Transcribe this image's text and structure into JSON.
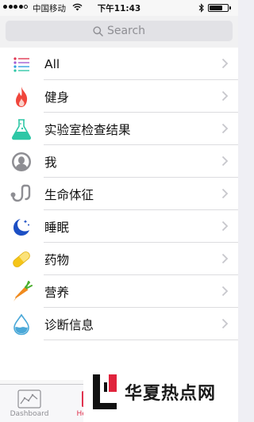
{
  "status_bar": {
    "carrier": "中国移动",
    "time": "下午11:43",
    "signal_dots_filled": 4,
    "battery_level": 0.65
  },
  "search": {
    "placeholder": "Search",
    "icon": "search-icon"
  },
  "categories": [
    {
      "label": "All",
      "icon": "list-icon"
    },
    {
      "label": "健身",
      "icon": "flame-icon"
    },
    {
      "label": "实验室检查结果",
      "icon": "flask-icon"
    },
    {
      "label": "我",
      "icon": "person-icon"
    },
    {
      "label": "生命体征",
      "icon": "stethoscope-icon"
    },
    {
      "label": "睡眠",
      "icon": "moon-icon"
    },
    {
      "label": "药物",
      "icon": "pill-icon"
    },
    {
      "label": "营养",
      "icon": "carrot-icon"
    },
    {
      "label": "诊断信息",
      "icon": "drop-icon"
    }
  ],
  "tab_bar": {
    "tabs": [
      {
        "label": "Dashboard",
        "icon": "dashboard-icon"
      },
      {
        "label": "Health",
        "icon": "health-data-icon"
      }
    ]
  },
  "watermark": {
    "text": "华夏热点网"
  },
  "colors": {
    "health_red": "#e0334f",
    "flame": "#f0463c",
    "flask": "#2ec7a6",
    "person": "#8e8e93",
    "stethoscope": "#8e8e93",
    "moon": "#1c4fc4",
    "pill": "#f5c518",
    "carrot": "#f08a1d",
    "drop": "#4aa8d8"
  }
}
